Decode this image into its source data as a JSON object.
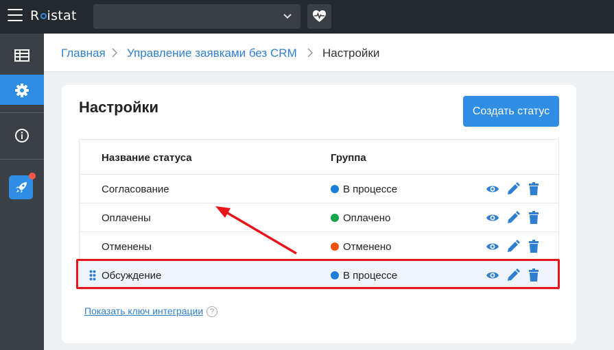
{
  "app": {
    "logo_text_pre": "R",
    "logo_text_post": "istat",
    "project_select_value": ""
  },
  "sidebar": {
    "items": [
      {
        "icon": "table-icon",
        "active": false
      },
      {
        "icon": "gear-icon",
        "active": true
      },
      {
        "icon": "info-icon",
        "active": false
      },
      {
        "icon": "rocket-icon",
        "badge": true
      }
    ]
  },
  "breadcrumb": {
    "home": "Главная",
    "section": "Управление заявками без CRM",
    "current": "Настройки"
  },
  "page": {
    "title": "Настройки",
    "create_button": "Создать статус",
    "integration_link": "Показать ключ интеграции",
    "help_mark": "?"
  },
  "table": {
    "headers": {
      "name": "Название статуса",
      "group": "Группа"
    },
    "rows": [
      {
        "name": "Согласование",
        "group": "В процессе",
        "color": "#1f7fd6"
      },
      {
        "name": "Оплачены",
        "group": "Оплачено",
        "color": "#16a34a"
      },
      {
        "name": "Отменены",
        "group": "Отменено",
        "color": "#f0540f"
      },
      {
        "name": "Обсуждение",
        "group": "В процессе",
        "color": "#1f7fd6"
      }
    ]
  },
  "colors": {
    "accent": "#2f8de4",
    "topbar": "#24292e",
    "sidebar": "#3b4046",
    "annotation": "#e8141c"
  }
}
